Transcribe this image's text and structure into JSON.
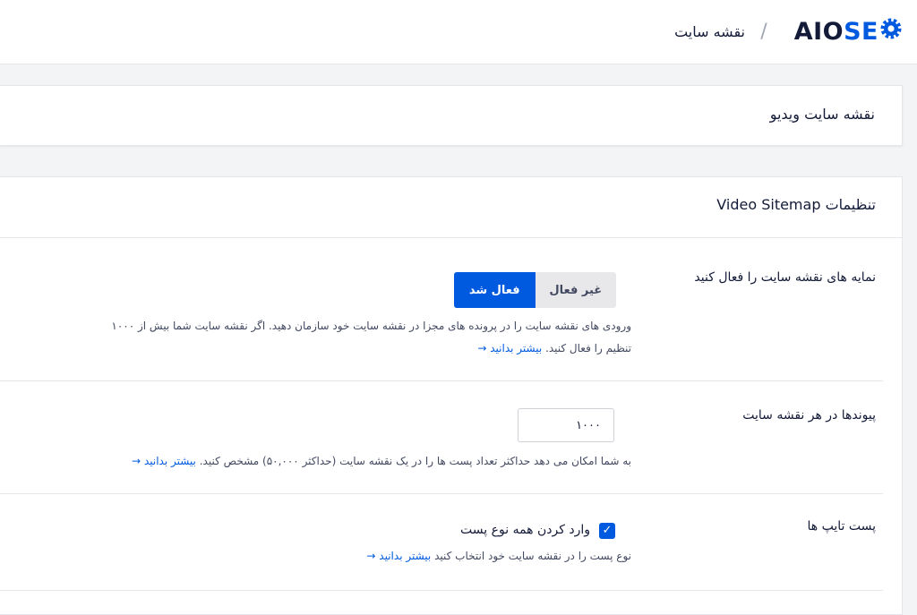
{
  "header": {
    "logo_left": "AIO",
    "logo_right": "SE",
    "logo_icon": "gear-icon",
    "separator": "/",
    "page_title": "نقشه سایت"
  },
  "card_video_sitemap": {
    "title": "نقشه سایت ویدیو"
  },
  "settings": {
    "title": "تنظیمات Video Sitemap",
    "enable_sitemap_indexes": {
      "label": "نمایه های نقشه سایت را فعال کنید",
      "toggle_off": "غیر فعال",
      "toggle_on": "فعال شد",
      "selected": "فعال شد",
      "desc_line1": "ورودی های نقشه سایت را در پرونده های مجزا در نقشه سایت خود سازمان دهید. اگر نقشه سایت شما بیش از ۱۰۰۰",
      "desc_line2": "تنظیم را فعال کنید.",
      "learn_more": "بیشتر بدانید",
      "arrow": "→"
    },
    "links_per_sitemap": {
      "label": "پیوندها در هر نقشه سایت",
      "value": "۱۰۰۰",
      "desc": "به شما امکان می دهد حداکثر تعداد پست ها را در یک نقشه سایت (حداکثر ۵۰,۰۰۰) مشخص کنید.",
      "learn_more": "بیشتر بدانید",
      "arrow": "→"
    },
    "post_types": {
      "label": "پست تایپ ها",
      "checkbox_label": "وارد کردن همه نوع پست",
      "checked": true,
      "check_mark": "✓",
      "desc": "نوع پست را در نقشه سایت خود انتخاب کنید",
      "learn_more": "بیشتر بدانید",
      "arrow": "→"
    }
  },
  "colors": {
    "accent": "#005ae0",
    "text": "#141b38",
    "muted": "#434960",
    "border": "#e4e6ea",
    "background": "#f3f4f5"
  }
}
